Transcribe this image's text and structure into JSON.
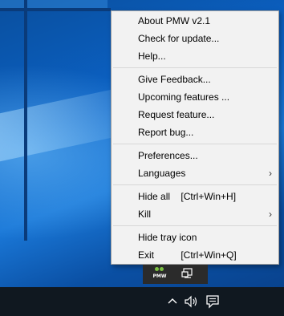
{
  "menu": {
    "groups": [
      {
        "items": [
          {
            "label": "About PMW v2.1"
          },
          {
            "label": "Check for update..."
          },
          {
            "label": "Help..."
          }
        ]
      },
      {
        "items": [
          {
            "label": "Give Feedback..."
          },
          {
            "label": "Upcoming features ..."
          },
          {
            "label": "Request feature..."
          },
          {
            "label": "Report bug..."
          }
        ]
      },
      {
        "items": [
          {
            "label": "Preferences..."
          },
          {
            "label": "Languages",
            "submenu": true
          }
        ]
      },
      {
        "items": [
          {
            "label": "Hide all    [Ctrl+Win+H]"
          },
          {
            "label": "Kill",
            "submenu": true
          }
        ]
      },
      {
        "items": [
          {
            "label": "Hide tray icon"
          },
          {
            "label": "Exit          [Ctrl+Win+Q]"
          }
        ]
      }
    ],
    "submenu_arrow": "›"
  },
  "tray": {
    "pmw_icon_text": "PMW",
    "pmw_icon_color": "#7cc242"
  },
  "taskbar": {
    "icons": [
      "chevron-up-icon",
      "speaker-icon",
      "notification-icon"
    ]
  }
}
